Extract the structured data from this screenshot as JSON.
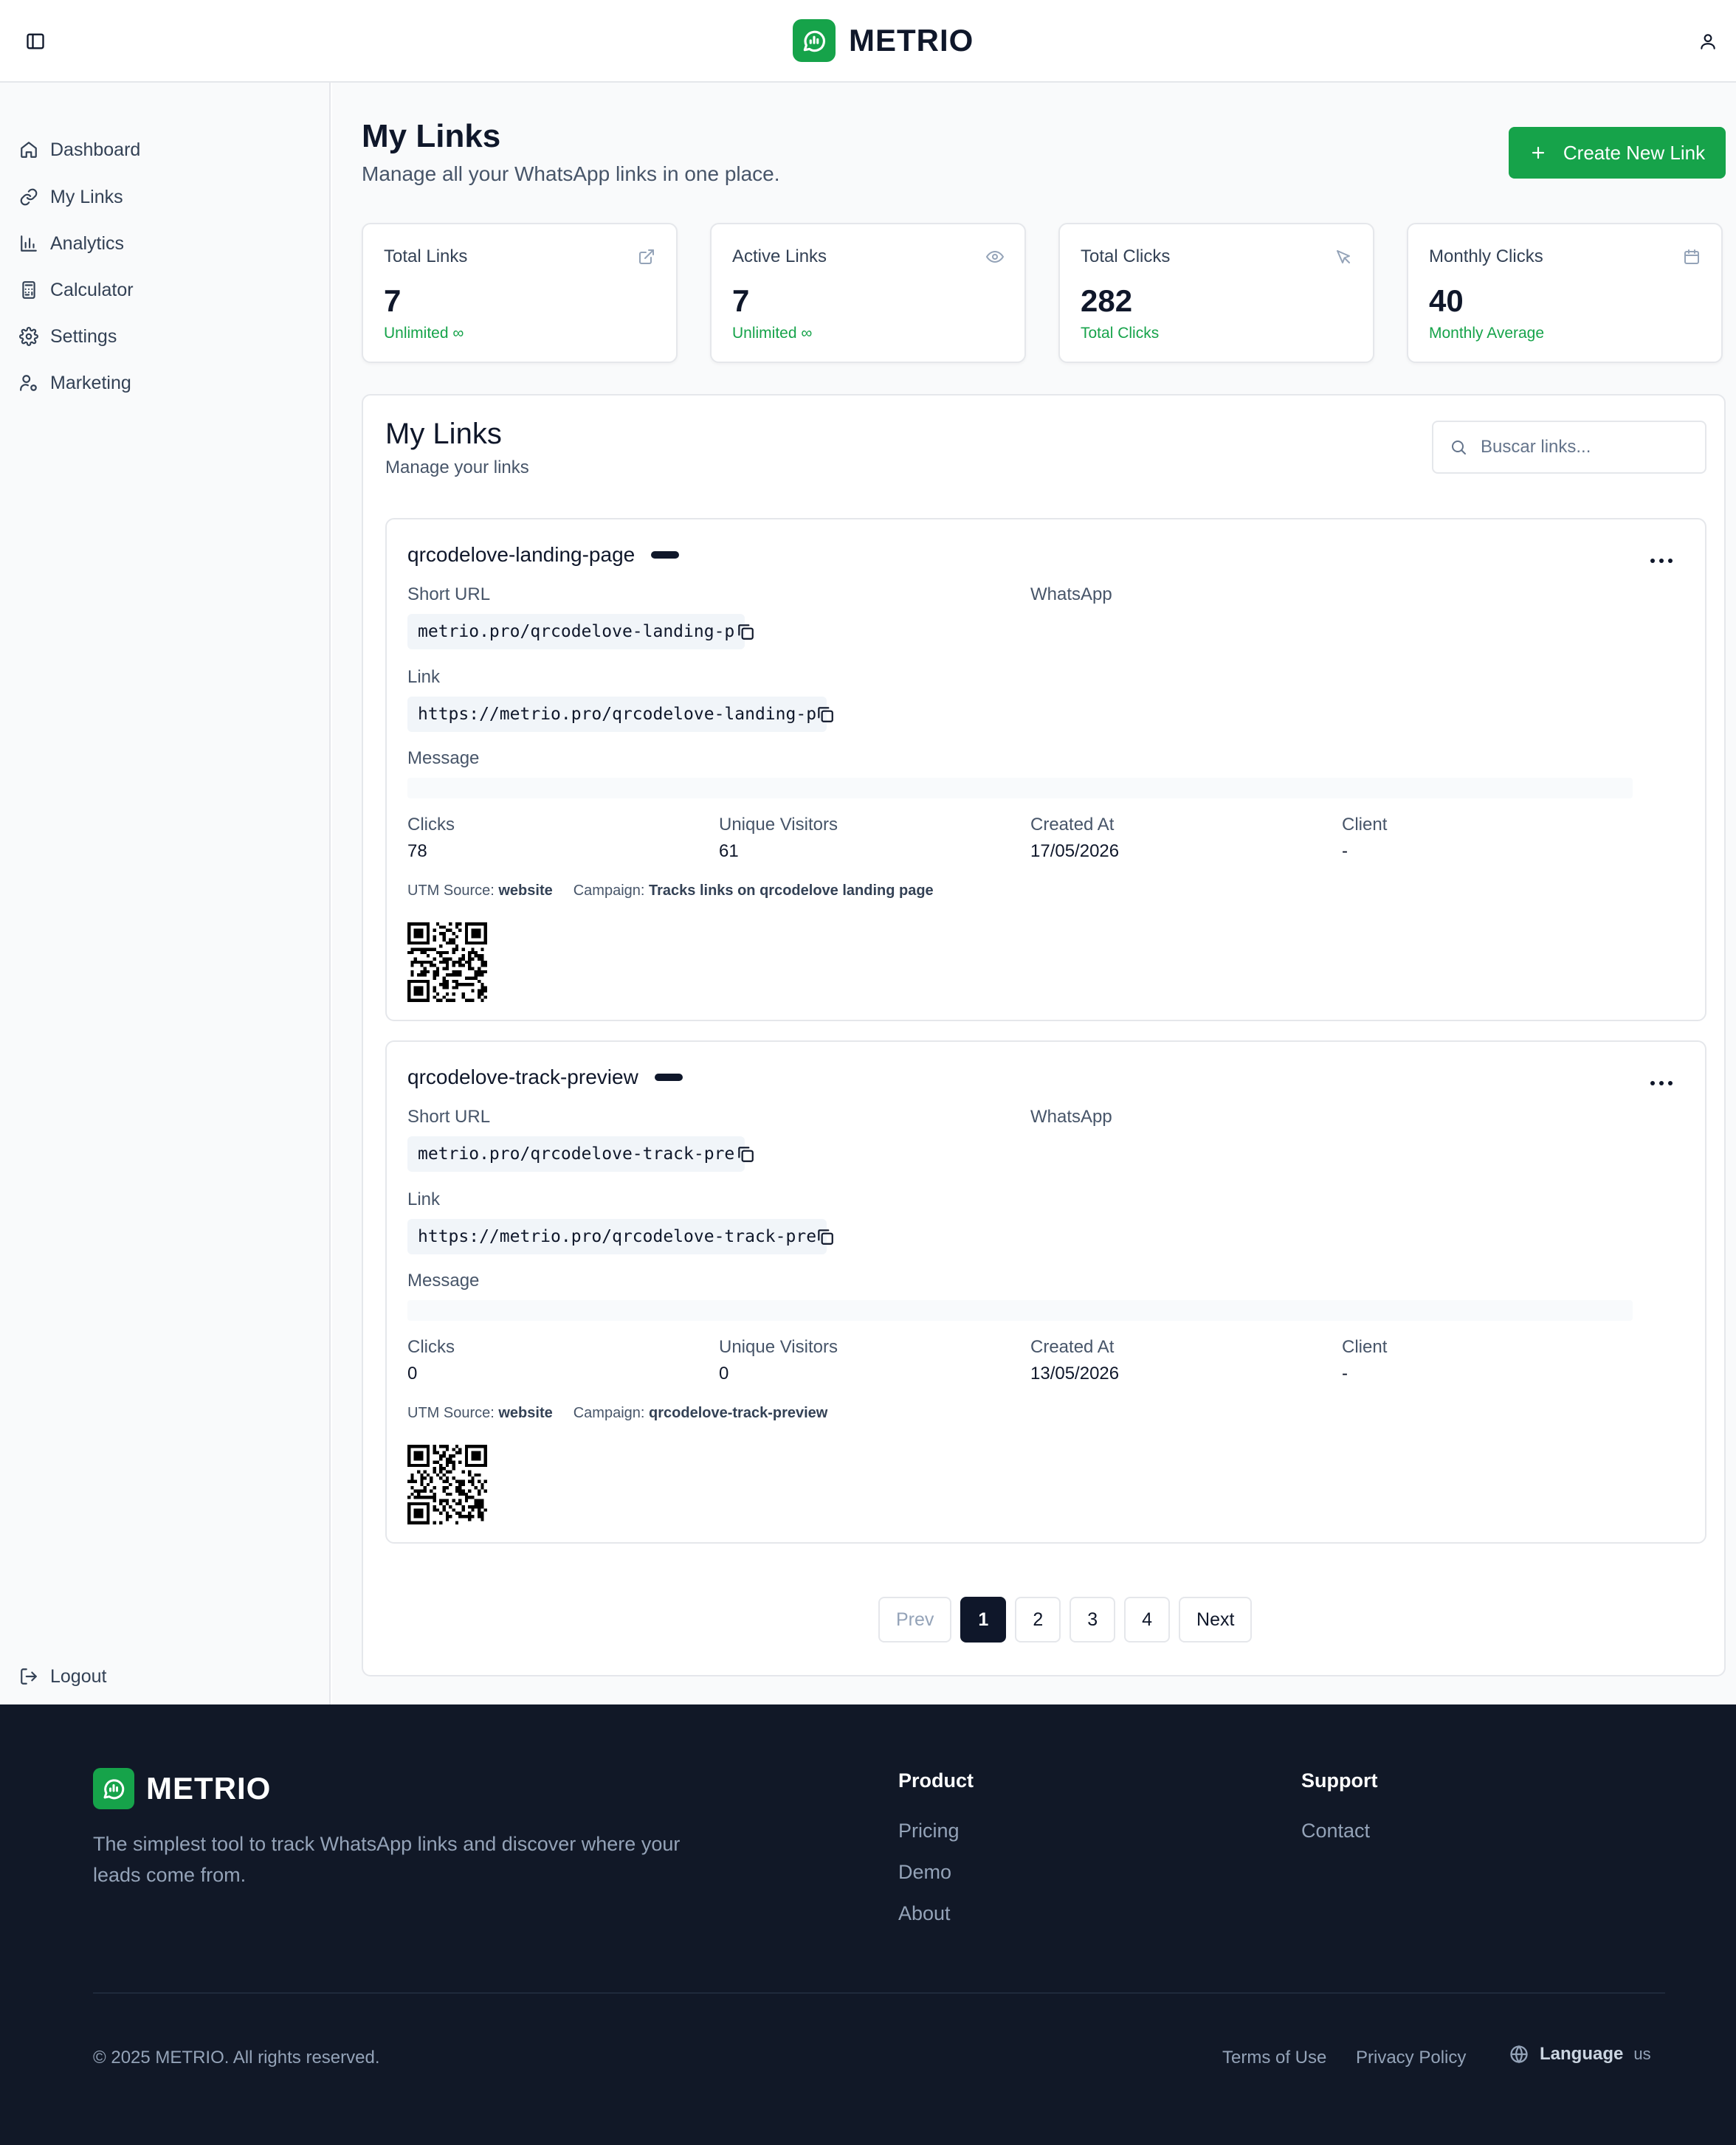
{
  "app": {
    "name": "METRIO"
  },
  "sidebar": {
    "items": [
      {
        "label": "Dashboard",
        "icon": "home-icon"
      },
      {
        "label": "My Links",
        "icon": "link-icon"
      },
      {
        "label": "Analytics",
        "icon": "bar-chart-icon"
      },
      {
        "label": "Calculator",
        "icon": "calculator-icon"
      },
      {
        "label": "Settings",
        "icon": "gear-icon"
      },
      {
        "label": "Marketing",
        "icon": "user-cog-icon"
      }
    ],
    "logout_label": "Logout"
  },
  "main": {
    "title": "My Links",
    "subtitle": "Manage all your WhatsApp links in one place.",
    "create_button_label": "Create New Link"
  },
  "stats": [
    {
      "label": "Total Links",
      "value": "7",
      "note": "Unlimited ∞",
      "icon": "external-link-icon"
    },
    {
      "label": "Active Links",
      "value": "7",
      "note": "Unlimited ∞",
      "icon": "eye-icon"
    },
    {
      "label": "Total Clicks",
      "value": "282",
      "note": "Total Clicks",
      "icon": "cursor-click-icon"
    },
    {
      "label": "Monthly Clicks",
      "value": "40",
      "note": "Monthly Average",
      "icon": "calendar-icon"
    }
  ],
  "links_panel": {
    "title": "My Links",
    "subtitle": "Manage your links",
    "search_placeholder": "Buscar links..."
  },
  "field_labels": {
    "short_url": "Short URL",
    "whatsapp": "WhatsApp",
    "link": "Link",
    "message": "Message",
    "clicks": "Clicks",
    "unique_visitors": "Unique Visitors",
    "created_at": "Created At",
    "client": "Client",
    "utm_source": "UTM Source:",
    "campaign": "Campaign:"
  },
  "links": [
    {
      "name": "qrcodelove-landing-page",
      "short_url": "metrio.pro/qrcodelove-landing-p",
      "link": "https://metrio.pro/qrcodelove-landing-p",
      "clicks": "78",
      "unique_visitors": "61",
      "created_at": "17/05/2026",
      "client": "-",
      "utm_source": "website",
      "campaign": "Tracks links on qrcodelove landing page"
    },
    {
      "name": "qrcodelove-track-preview",
      "short_url": "metrio.pro/qrcodelove-track-pre",
      "link": "https://metrio.pro/qrcodelove-track-pre",
      "clicks": "0",
      "unique_visitors": "0",
      "created_at": "13/05/2026",
      "client": "-",
      "utm_source": "website",
      "campaign": "qrcodelove-track-preview"
    }
  ],
  "pagination": {
    "prev": "Prev",
    "pages": [
      "1",
      "2",
      "3",
      "4"
    ],
    "current": "1",
    "next": "Next"
  },
  "footer": {
    "brand": "METRIO",
    "tagline": "The simplest tool to track WhatsApp links and discover where your leads come from.",
    "product": {
      "title": "Product",
      "links": [
        "Pricing",
        "Demo",
        "About"
      ]
    },
    "support": {
      "title": "Support",
      "links": [
        "Contact"
      ]
    },
    "copyright": "© 2025 METRIO. All rights reserved.",
    "terms": "Terms of Use",
    "privacy": "Privacy Policy",
    "language_label": "Language",
    "language_code": "us"
  },
  "colors": {
    "brand": "#16a34a",
    "dark": "#0f172a",
    "footer_bg": "#111827"
  }
}
